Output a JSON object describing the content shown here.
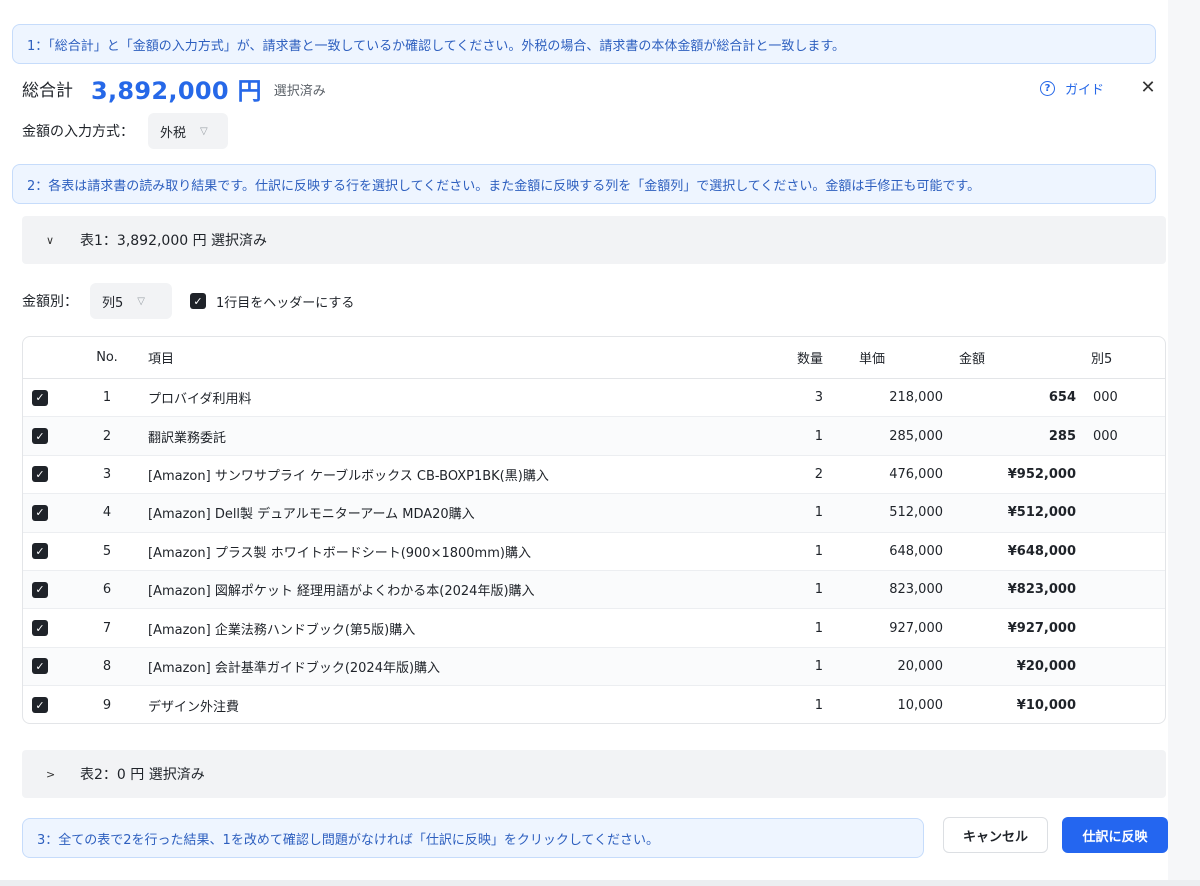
{
  "hints": {
    "step1": "1：「総合計」と「金額の入力方式」が、請求書と一致しているか確認してください。外税の場合、請求書の本体金額が総合計と一致します。",
    "step2": "2：各表は請求書の読み取り結果です。仕訳に反映する行を選択してください。また金額に反映する列を「金額列」で選択してください。金額は手修正も可能です。",
    "step3": "3：全ての表で2を行った結果、1を改めて確認し問題がなければ「仕訳に反映」をクリックしてください。"
  },
  "total": {
    "label": "総合計",
    "amount": "3,892,000 円",
    "status": "選択済み"
  },
  "header": {
    "guide_label": "ガイド",
    "guide_icon": "question-circle-icon",
    "close_icon": "close-icon"
  },
  "input_mode": {
    "label": "金額の入力方式：",
    "value": "外税"
  },
  "table1": {
    "title": "表1：3,892,000 円 選択済み",
    "expanded": true,
    "amount_column_label": "金額別：",
    "amount_column_value": "列5",
    "header_row_label": "1行目をヘッダーにする",
    "header_row_checked": true,
    "columns": {
      "no": "No.",
      "item": "項目",
      "qty": "数量",
      "price": "単価",
      "amount": "金額",
      "col5": "別5"
    },
    "rows": [
      {
        "no": "1",
        "item": "プロバイダ利用料",
        "qty": "3",
        "price": "218,000",
        "amount": "654",
        "col5": "000",
        "checked": true
      },
      {
        "no": "2",
        "item": "翻訳業務委託",
        "qty": "1",
        "price": "285,000",
        "amount": "285",
        "col5": "000",
        "checked": true
      },
      {
        "no": "3",
        "item": "[Amazon] サンワサプライ ケーブルボックス CB-BOXP1BK(黒)購入",
        "qty": "2",
        "price": "476,000",
        "amount": "¥952,000",
        "col5": "",
        "checked": true
      },
      {
        "no": "4",
        "item": "[Amazon] Dell製 デュアルモニターアーム MDA20購入",
        "qty": "1",
        "price": "512,000",
        "amount": "¥512,000",
        "col5": "",
        "checked": true
      },
      {
        "no": "5",
        "item": "[Amazon] プラス製 ホワイトボードシート(900×1800mm)購入",
        "qty": "1",
        "price": "648,000",
        "amount": "¥648,000",
        "col5": "",
        "checked": true
      },
      {
        "no": "6",
        "item": "[Amazon] 図解ポケット 経理用語がよくわかる本(2024年版)購入",
        "qty": "1",
        "price": "823,000",
        "amount": "¥823,000",
        "col5": "",
        "checked": true
      },
      {
        "no": "7",
        "item": "[Amazon] 企業法務ハンドブック(第5版)購入",
        "qty": "1",
        "price": "927,000",
        "amount": "¥927,000",
        "col5": "",
        "checked": true
      },
      {
        "no": "8",
        "item": "[Amazon] 会計基準ガイドブック(2024年版)購入",
        "qty": "1",
        "price": "20,000",
        "amount": "¥20,000",
        "col5": "",
        "checked": true
      },
      {
        "no": "9",
        "item": "デザイン外注費",
        "qty": "1",
        "price": "10,000",
        "amount": "¥10,000",
        "col5": "",
        "checked": true
      }
    ]
  },
  "table2": {
    "title": "表2：0 円 選択済み",
    "expanded": false
  },
  "buttons": {
    "cancel": "キャンセル",
    "apply": "仕訳に反映"
  },
  "colors": {
    "accent": "#2668e8",
    "primary_button": "#2466f0",
    "hint_background": "#eef5ff",
    "hint_text": "#2d5fbf"
  }
}
